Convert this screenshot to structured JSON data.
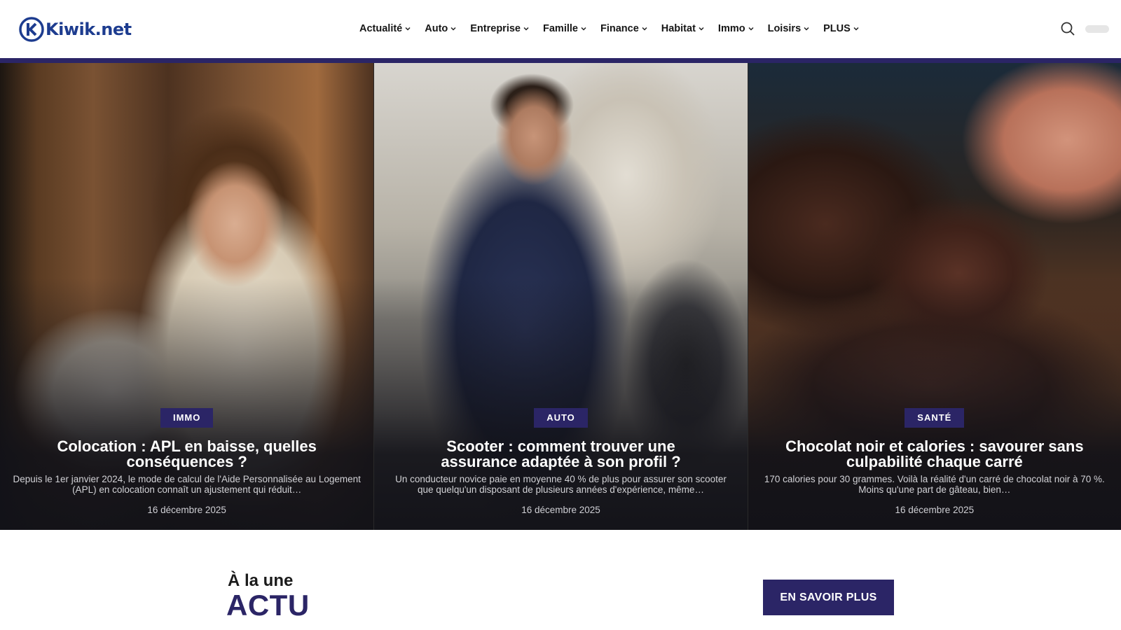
{
  "site": {
    "name": "Kiwik.net"
  },
  "nav": {
    "items": [
      {
        "label": "Actualité"
      },
      {
        "label": "Auto"
      },
      {
        "label": "Entreprise"
      },
      {
        "label": "Famille"
      },
      {
        "label": "Finance"
      },
      {
        "label": "Habitat"
      },
      {
        "label": "Immo"
      },
      {
        "label": "Loisirs"
      },
      {
        "label": "PLUS"
      }
    ]
  },
  "hero": {
    "cards": [
      {
        "category": "IMMO",
        "title": "Colocation : APL en baisse, quelles conséquences ?",
        "excerpt": "Depuis le 1er janvier 2024, le mode de calcul de l'Aide Personnalisée au Logement (APL) en colocation connaît un ajustement qui réduit…",
        "date": "16 décembre 2025"
      },
      {
        "category": "AUTO",
        "title": "Scooter : comment trouver une assurance adaptée à son profil ?",
        "excerpt": "Un conducteur novice paie en moyenne 40 % de plus pour assurer son scooter que quelqu'un disposant de plusieurs années d'expérience, même…",
        "date": "16 décembre 2025"
      },
      {
        "category": "SANTÉ",
        "title": "Chocolat noir et calories : savourer sans culpabilité chaque carré",
        "excerpt": "170 calories pour 30 grammes. Voilà la réalité d'un carré de chocolat noir à 70 %. Moins qu'une part de gâteau, bien…",
        "date": "16 décembre 2025"
      }
    ]
  },
  "section": {
    "kicker": "À la une",
    "title": "ACTU",
    "cta_label": "EN SAVOIR PLUS"
  },
  "colors": {
    "brand": "#2b2566",
    "logo": "#1d3c8f"
  }
}
